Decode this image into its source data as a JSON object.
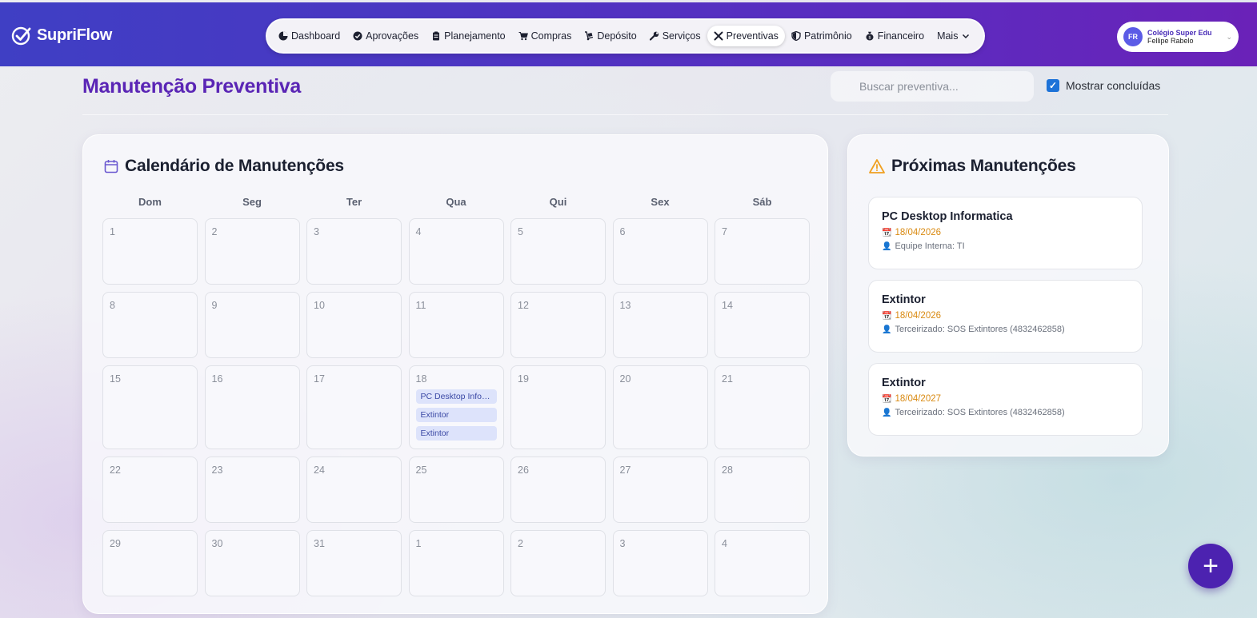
{
  "app": {
    "brand": "SupriFlow"
  },
  "nav": [
    {
      "label": "Dashboard",
      "icon": "dashboard-icon"
    },
    {
      "label": "Aprovações",
      "icon": "check-circle-icon"
    },
    {
      "label": "Planejamento",
      "icon": "clipboard-icon"
    },
    {
      "label": "Compras",
      "icon": "cart-icon"
    },
    {
      "label": "Depósito",
      "icon": "dolly-icon"
    },
    {
      "label": "Serviços",
      "icon": "wrench-icon"
    },
    {
      "label": "Preventivas",
      "icon": "tools-icon",
      "active": true
    },
    {
      "label": "Patrimônio",
      "icon": "shield-icon"
    },
    {
      "label": "Financeiro",
      "icon": "money-bag-icon"
    },
    {
      "label": "Mais",
      "icon": "chevron-down-icon"
    }
  ],
  "profile": {
    "initials": "FR",
    "org": "Colégio Super Edu",
    "user": "Fellipe Rabelo"
  },
  "page": {
    "title": "Manutenção Preventiva"
  },
  "search": {
    "placeholder": "Buscar preventiva..."
  },
  "filter": {
    "show_completed_label": "Mostrar concluídas",
    "checked": true
  },
  "calendar": {
    "title": "Calendário de Manutenções",
    "weekdays": [
      "Dom",
      "Seg",
      "Ter",
      "Qua",
      "Qui",
      "Sex",
      "Sáb"
    ],
    "weeks": [
      [
        {
          "d": "1"
        },
        {
          "d": "2"
        },
        {
          "d": "3"
        },
        {
          "d": "4"
        },
        {
          "d": "5"
        },
        {
          "d": "6"
        },
        {
          "d": "7"
        }
      ],
      [
        {
          "d": "8"
        },
        {
          "d": "9"
        },
        {
          "d": "10"
        },
        {
          "d": "11"
        },
        {
          "d": "12"
        },
        {
          "d": "13"
        },
        {
          "d": "14"
        }
      ],
      [
        {
          "d": "15"
        },
        {
          "d": "16"
        },
        {
          "d": "17"
        },
        {
          "d": "18",
          "events": [
            "PC Desktop Informatica",
            "Extintor",
            "Extintor"
          ]
        },
        {
          "d": "19"
        },
        {
          "d": "20"
        },
        {
          "d": "21"
        }
      ],
      [
        {
          "d": "22"
        },
        {
          "d": "23"
        },
        {
          "d": "24"
        },
        {
          "d": "25"
        },
        {
          "d": "26"
        },
        {
          "d": "27"
        },
        {
          "d": "28"
        }
      ],
      [
        {
          "d": "29"
        },
        {
          "d": "30"
        },
        {
          "d": "31"
        },
        {
          "d": "1"
        },
        {
          "d": "2"
        },
        {
          "d": "3"
        },
        {
          "d": "4"
        }
      ]
    ]
  },
  "upcoming": {
    "title": "Próximas Manutenções",
    "items": [
      {
        "name": "PC Desktop Informatica",
        "date": "18/04/2026",
        "responsible": "Equipe Interna: TI"
      },
      {
        "name": "Extintor",
        "date": "18/04/2026",
        "responsible": "Terceirizado: SOS Extintores (4832462858)"
      },
      {
        "name": "Extintor",
        "date": "18/04/2027",
        "responsible": "Terceirizado: SOS Extintores (4832462858)"
      }
    ]
  },
  "fab": {
    "label": "+"
  },
  "colors": {
    "accent": "#5a25b5",
    "event_bg": "#dde3fb",
    "date": "#d98a12",
    "header_from": "#3f3fc4",
    "header_to": "#6a22b8"
  }
}
